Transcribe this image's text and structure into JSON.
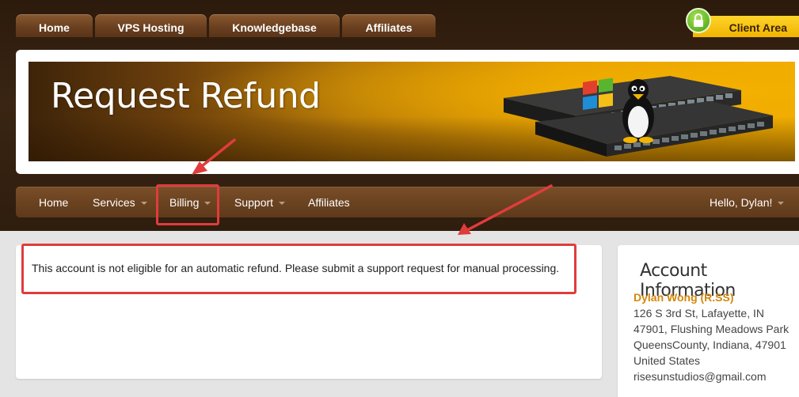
{
  "top_tabs": [
    "Home",
    "VPS Hosting",
    "Knowledgebase",
    "Affiliates"
  ],
  "client_area": {
    "label": "Client Area",
    "icon": "lock-icon"
  },
  "banner": {
    "title": "Request Refund",
    "graphic": "server-switch-icon"
  },
  "nav": {
    "items": [
      {
        "label": "Home",
        "dropdown": false
      },
      {
        "label": "Services",
        "dropdown": true
      },
      {
        "label": "Billing",
        "dropdown": true
      },
      {
        "label": "Support",
        "dropdown": true
      },
      {
        "label": "Affiliates",
        "dropdown": false
      }
    ],
    "user_menu": "Hello, Dylan!"
  },
  "alert": {
    "message": "This account is not eligible for an automatic refund. Please submit a support request for manual processing."
  },
  "account_info": {
    "title": "Account Information",
    "name": "Dylan Wong (R.SS)",
    "lines": [
      "126 S 3rd St, Lafayette, IN",
      "47901, Flushing Meadows Park",
      "QueensCounty, Indiana, 47901",
      "United States",
      "risesunstudios@gmail.com"
    ]
  },
  "colors": {
    "accent_orange": "#d4870c",
    "annotation_red": "#e03c3c",
    "nav_brown": "#6a4220",
    "client_area_yellow": "#ffd42a"
  }
}
